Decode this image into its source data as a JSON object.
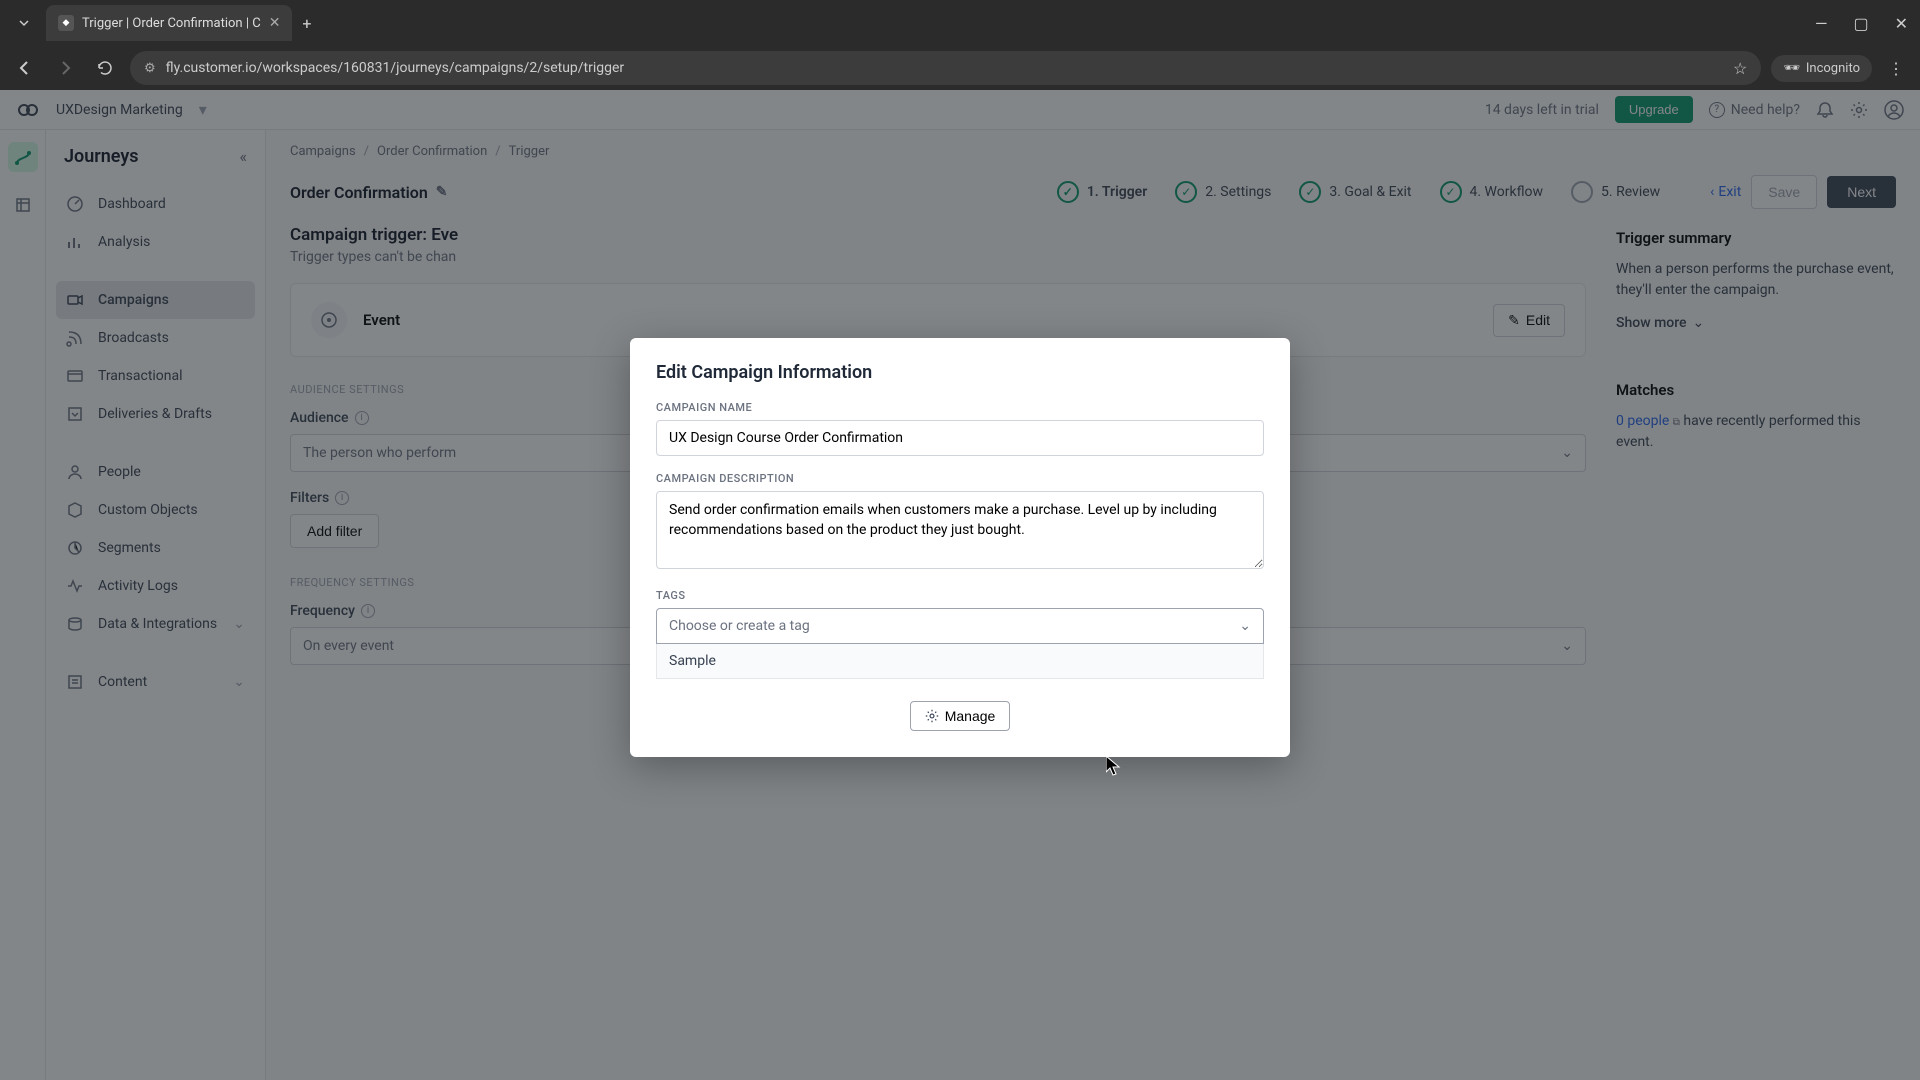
{
  "browser": {
    "tab_title": "Trigger | Order Confirmation | C",
    "url": "fly.customer.io/workspaces/160831/journeys/campaigns/2/setup/trigger",
    "incognito": "Incognito"
  },
  "topbar": {
    "workspace": "UXDesign Marketing",
    "trial": "14 days left in trial",
    "upgrade": "Upgrade",
    "need_help": "Need help?"
  },
  "sidebar": {
    "title": "Journeys",
    "items": [
      "Dashboard",
      "Analysis",
      "Campaigns",
      "Broadcasts",
      "Transactional",
      "Deliveries & Drafts",
      "People",
      "Custom Objects",
      "Segments",
      "Activity Logs",
      "Data & Integrations",
      "Content"
    ]
  },
  "breadcrumbs": [
    "Campaigns",
    "Order Confirmation",
    "Trigger"
  ],
  "header": {
    "campaign_name": "Order Confirmation",
    "steps": [
      "1. Trigger",
      "2. Settings",
      "3. Goal & Exit",
      "4. Workflow",
      "5. Review"
    ],
    "exit": "Exit",
    "save": "Save",
    "next": "Next"
  },
  "main": {
    "trigger_title": "Campaign trigger: Eve",
    "trigger_sub": "Trigger types can't be chan",
    "event_label": "Event",
    "edit": "Edit",
    "audience_settings": "AUDIENCE SETTINGS",
    "audience": "Audience",
    "audience_value": "The person who perform",
    "filters": "Filters",
    "add_filter": "Add filter",
    "frequency_settings": "FREQUENCY SETTINGS",
    "frequency": "Frequency",
    "frequency_value": "On every event"
  },
  "summary": {
    "title": "Trigger summary",
    "text": "When a person performs the purchase event, they'll enter the campaign.",
    "show_more": "Show more",
    "matches": "Matches",
    "people_count": "0 people",
    "matches_text": "have recently performed this event."
  },
  "modal": {
    "title": "Edit Campaign Information",
    "name_label": "CAMPAIGN NAME",
    "name_value": "UX Design Course Order Confirmation",
    "desc_label": "CAMPAIGN DESCRIPTION",
    "desc_value": "Send order confirmation emails when customers make a purchase. Level up by including recommendations based on the product they just bought.",
    "tags_label": "TAGS",
    "tags_placeholder": "Choose or create a tag",
    "tag_option": "Sample",
    "manage": "Manage"
  }
}
